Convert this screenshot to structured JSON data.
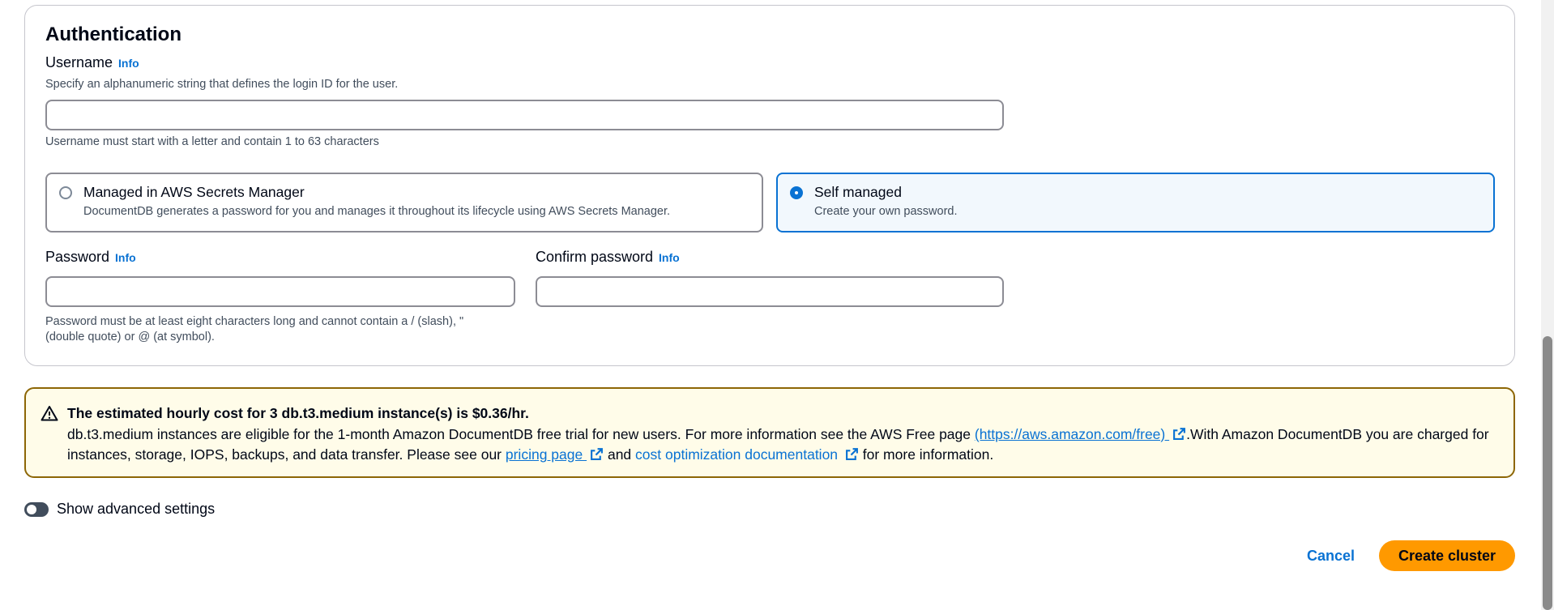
{
  "authentication": {
    "title": "Authentication",
    "info_label": "Info",
    "username": {
      "label": "Username",
      "description": "Specify an alphanumeric string that defines the login ID for the user.",
      "value": "",
      "constraint": "Username must start with a letter and contain 1 to 63 characters"
    },
    "password_mode": {
      "options": [
        {
          "title": "Managed in AWS Secrets Manager",
          "description": "DocumentDB generates a password for you and manages it throughout its lifecycle using AWS Secrets Manager.",
          "selected": false
        },
        {
          "title": "Self managed",
          "description": "Create your own password.",
          "selected": true
        }
      ]
    },
    "password": {
      "label": "Password",
      "value": "",
      "constraint_line1": "Password must be at least eight characters long and cannot contain a / (slash), \"",
      "constraint_line2": "(double quote) or @ (at symbol)."
    },
    "confirm_password": {
      "label": "Confirm password",
      "value": ""
    }
  },
  "cost_alert": {
    "header": "The estimated hourly cost for 3 db.t3.medium instance(s) is $0.36/hr.",
    "body_part1": "db.t3.medium instances are eligible for the 1-month Amazon DocumentDB free trial for new users. For more information see the AWS Free page ",
    "free_link": "(https://aws.amazon.com/free) ",
    "body_part2": ".With Amazon DocumentDB you are charged for instances, storage, IOPS, backups, and data transfer. Please see our ",
    "pricing_link": "pricing page ",
    "body_part3": " and ",
    "cost_link": "cost optimization documentation ",
    "body_part4": " for more information."
  },
  "advanced": {
    "toggle_label": "Show advanced settings",
    "enabled": false
  },
  "actions": {
    "cancel_label": "Cancel",
    "create_label": "Create cluster"
  },
  "colors": {
    "accent": "#0972d3",
    "primary_button": "#ff9900",
    "warning_border": "#8d6605",
    "warning_bg": "#fffce9"
  }
}
